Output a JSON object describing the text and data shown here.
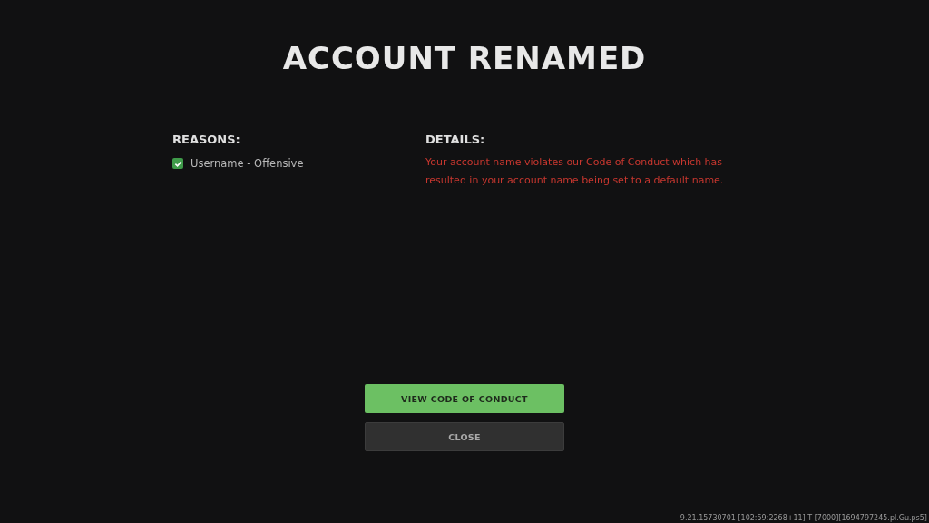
{
  "title": "ACCOUNT RENAMED",
  "reasons": {
    "heading": "REASONS:",
    "items": [
      {
        "label": "Username - Offensive",
        "checked": true
      }
    ]
  },
  "details": {
    "heading": "DETAILS:",
    "text": "Your account name violates our Code of Conduct which has resulted in your account name being set to a default name."
  },
  "buttons": [
    {
      "label": "VIEW CODE OF CONDUCT",
      "kind": "primary"
    },
    {
      "label": "CLOSE",
      "kind": "secondary"
    }
  ],
  "build_info": "9.21.15730701 [102:59:2268+11] T [7000][1694797245.pl.Gu.ps5]"
}
